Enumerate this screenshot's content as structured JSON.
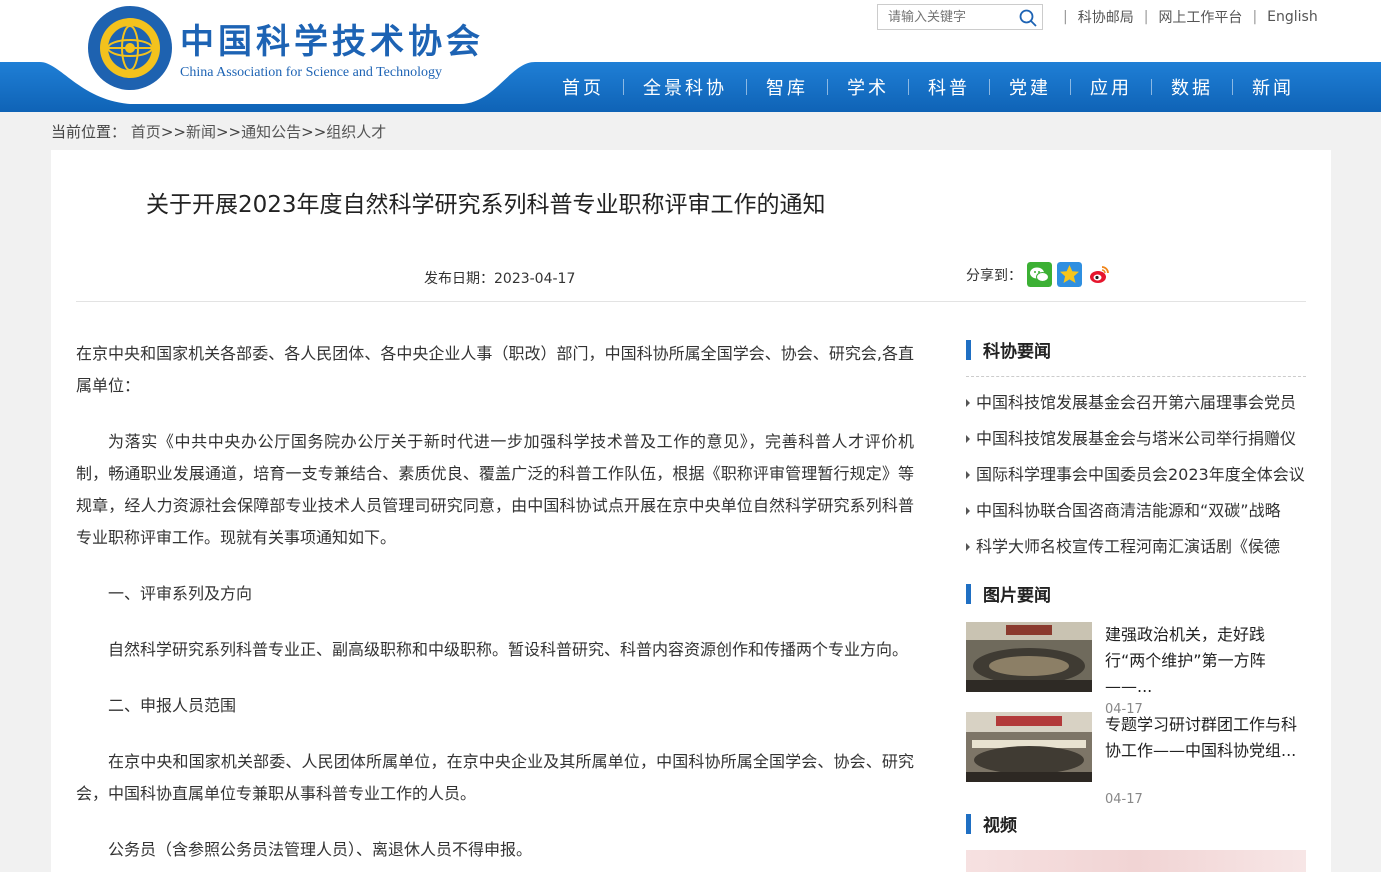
{
  "header": {
    "logo_cn": "中国科学技术协会",
    "logo_en": "China Association for Science and Technology",
    "search_placeholder": "请输入关键字",
    "top_links": [
      "科协邮局",
      "网上工作平台",
      "English"
    ],
    "nav": [
      "首页",
      "全景科协",
      "智库",
      "学术",
      "科普",
      "党建",
      "应用",
      "数据",
      "新闻"
    ]
  },
  "breadcrumb": {
    "label": "当前位置：",
    "items": [
      "首页",
      "新闻",
      "通知公告",
      "组织人才"
    ],
    "separator": ">>"
  },
  "article": {
    "title": "关于开展2023年度自然科学研究系列科普专业职称评审工作的通知",
    "date_label": "发布日期：",
    "date": "2023-04-17",
    "share_label": "分享到：",
    "paragraphs": [
      "在京中央和国家机关各部委、各人民团体、各中央企业人事（职改）部门，中国科协所属全国学会、协会、研究会,各直属单位：",
      "为落实《中共中央办公厅国务院办公厅关于新时代进一步加强科学技术普及工作的意见》，完善科普人才评价机制，畅通职业发展通道，培育一支专兼结合、素质优良、覆盖广泛的科普工作队伍，根据《职称评审管理暂行规定》等规章，经人力资源社会保障部专业技术人员管理司研究同意，由中国科协试点开展在京中央单位自然科学研究系列科普专业职称评审工作。现就有关事项通知如下。",
      "一、评审系列及方向",
      "自然科学研究系列科普专业正、副高级职称和中级职称。暂设科普研究、科普内容资源创作和传播两个专业方向。",
      "二、申报人员范围",
      "在京中央和国家机关部委、人民团体所属单位，在京中央企业及其所属单位，中国科协所属全国学会、协会、研究会，中国科协直属单位专兼职从事科普专业工作的人员。",
      "公务员（含参照公务员法管理人员）、离退休人员不得申报。"
    ]
  },
  "sidebar": {
    "news_heading": "科协要闻",
    "news": [
      "中国科技馆发展基金会召开第六届理事会党员",
      "中国科技馆发展基金会与塔米公司举行捐赠仪",
      "国际科学理事会中国委员会2023年度全体会议",
      "中国科协联合国咨商清洁能源和“双碳”战略",
      "科学大师名校宣传工程河南汇演话剧《侯德"
    ],
    "pic_heading": "图片要闻",
    "pics": [
      {
        "title": "建强政治机关，走好践行“两个维护”第一方阵——...",
        "date": "04-17"
      },
      {
        "title": "专题学习研讨群团工作与科协工作——中国科协党组...",
        "date": "04-17"
      }
    ],
    "video_heading": "视频"
  },
  "colors": {
    "nav_blue": "#1470c8",
    "accent_bar": "#1f6fc3"
  }
}
